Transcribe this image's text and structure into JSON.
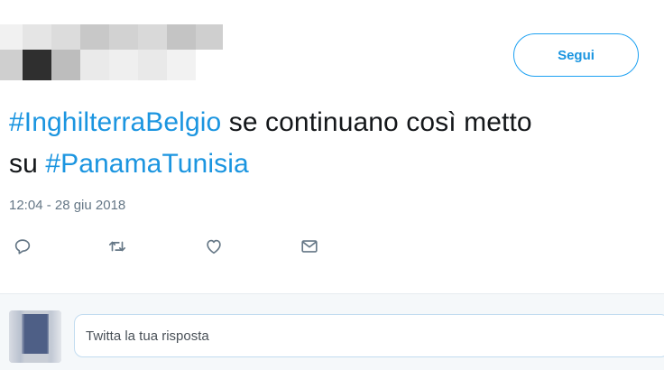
{
  "header": {
    "follow_label": "Segui"
  },
  "tweet": {
    "hashtag_1": "#InghilterraBelgio",
    "text_1": " se continuano così metto",
    "text_2": "su ",
    "hashtag_2": "#PanamaTunisia",
    "timestamp": "12:04 - 28 giu 2018"
  },
  "actions": [
    {
      "icon": "reply-icon"
    },
    {
      "icon": "retweet-icon"
    },
    {
      "icon": "like-icon"
    },
    {
      "icon": "direct-message-icon"
    }
  ],
  "reply": {
    "placeholder": "Twitta la tua risposta"
  },
  "colors": {
    "link": "#1b95e0",
    "text": "#14171a",
    "muted": "#657786",
    "icon": "#657786"
  }
}
